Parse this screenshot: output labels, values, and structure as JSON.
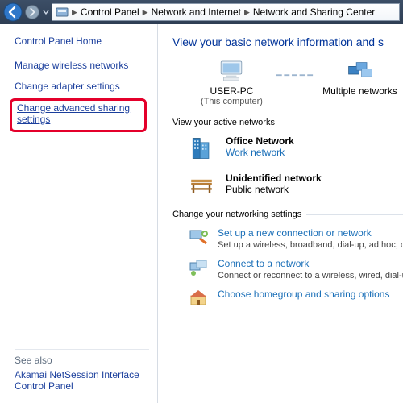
{
  "breadcrumb": {
    "items": [
      "Control Panel",
      "Network and Internet",
      "Network and Sharing Center"
    ]
  },
  "sidebar": {
    "home": "Control Panel Home",
    "links": {
      "wireless": "Manage wireless networks",
      "adapter": "Change adapter settings",
      "advanced": "Change advanced sharing settings"
    },
    "seealso_label": "See also",
    "akamai": "Akamai NetSession Interface Control Panel"
  },
  "main": {
    "heading": "View your basic network information and s",
    "diagram": {
      "pc": "USER-PC",
      "pc_sub": "(This computer)",
      "multi": "Multiple networks"
    },
    "active_label": "View your active networks",
    "networks": [
      {
        "name": "Office Network",
        "type": "Work network",
        "type_link": true
      },
      {
        "name": "Unidentified network",
        "type": "Public network",
        "type_link": false
      }
    ],
    "settings_label": "Change your networking settings",
    "options": [
      {
        "link": "Set up a new connection or network",
        "desc": "Set up a wireless, broadband, dial-up, ad hoc, or "
      },
      {
        "link": "Connect to a network",
        "desc": "Connect or reconnect to a wireless, wired, dial-up"
      },
      {
        "link": "Choose homegroup and sharing options",
        "desc": ""
      }
    ]
  }
}
